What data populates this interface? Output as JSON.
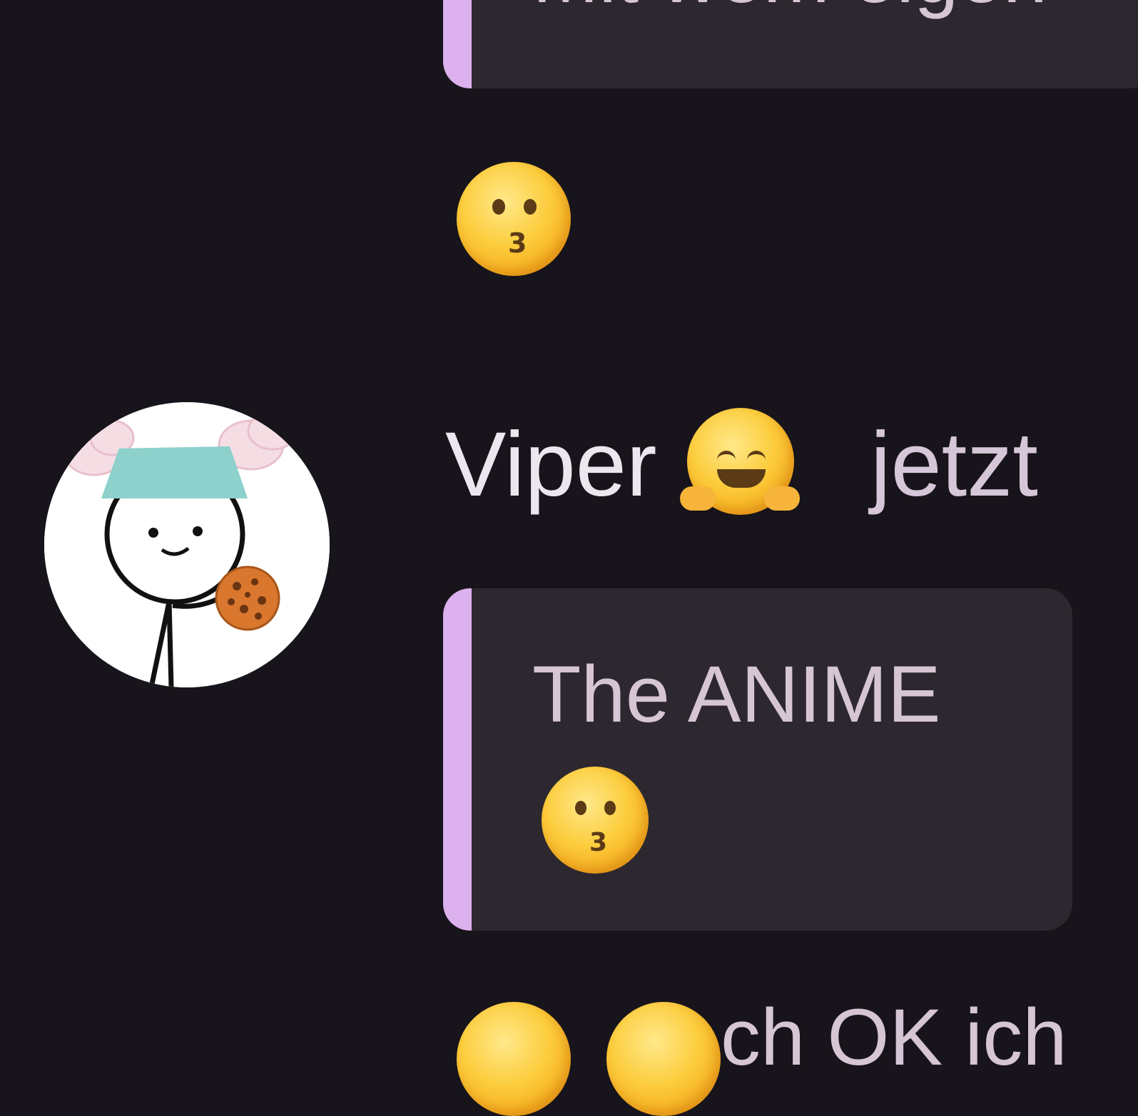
{
  "messages": {
    "top_quote_text": "Mit wem eigen",
    "kiss_emoji_alt": "kissing-face",
    "sender_name": "Viper",
    "sender_badge_emoji": "hugging-face",
    "timestamp": "jetzt",
    "reply_quote_text": "The ANIME",
    "reply_quote_emoji": "kissing-face",
    "bottom_partial_text": "ch OK ich"
  },
  "colors": {
    "background": "#18141b",
    "quote_bg": "#2d282f",
    "quote_accent": "#dcb1ee",
    "text": "#eee6ef"
  },
  "icons": [
    "kissing-face-icon",
    "hugging-face-icon",
    "saluting-face-icon",
    "avatar-stickman-with-cookie"
  ]
}
